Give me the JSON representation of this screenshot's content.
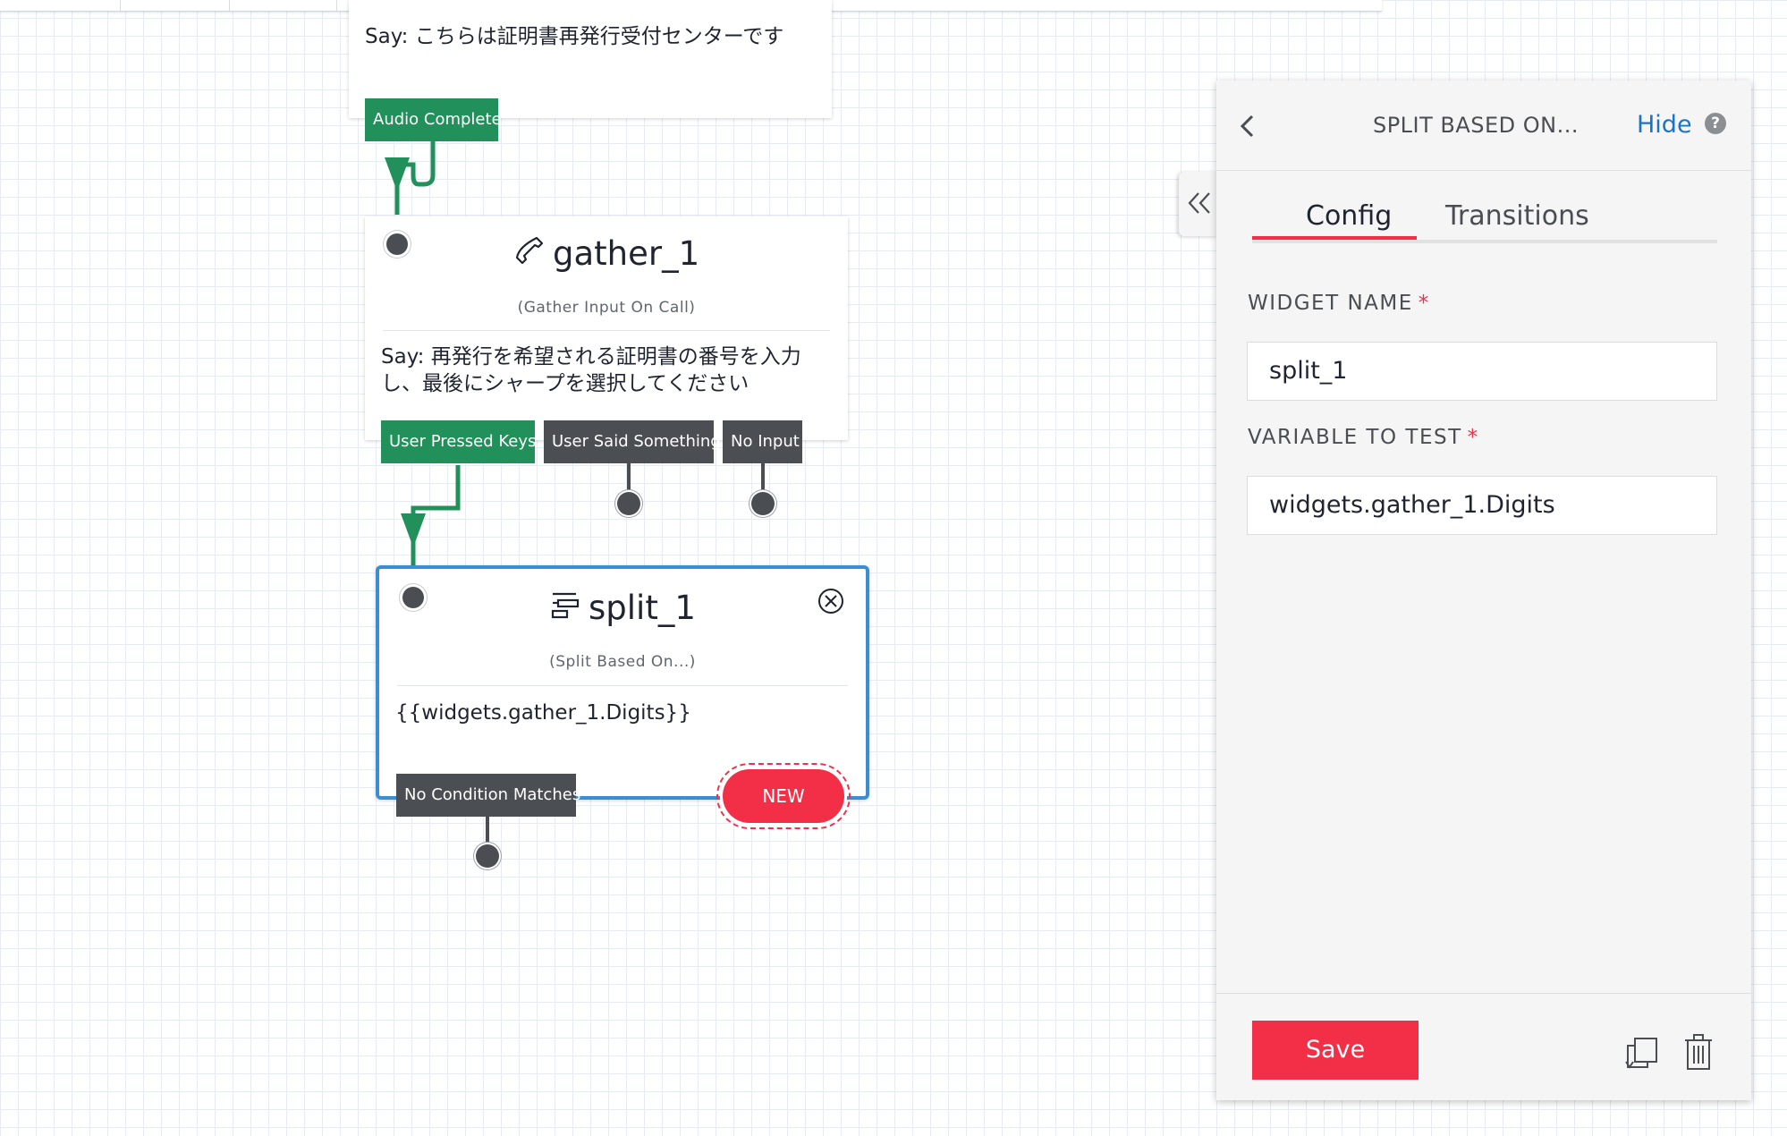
{
  "toolbar": {},
  "widgets": {
    "say_top": {
      "text": "Say: こちらは証明書再発行受付センターです"
    },
    "gather": {
      "title": "gather_1",
      "subtitle": "(Gather Input On Call)",
      "text": "Say: 再発行を希望される証明書の番号を入力し、最後にシャープを選択してください",
      "icon": "phone-icon"
    },
    "split": {
      "title": "split_1",
      "subtitle": "(Split Based On...)",
      "text": "{{widgets.gather_1.Digits}}",
      "icon": "split-icon",
      "new_label": "NEW"
    }
  },
  "transitions": {
    "audio_complete": "Audio Complete",
    "user_pressed_keys": "User Pressed Keys",
    "user_said_something": "User Said Something",
    "no_input": "No Input",
    "no_condition_matches": "No Condition Matches"
  },
  "panel": {
    "title": "SPLIT BASED ON...",
    "hide_label": "Hide",
    "help_glyph": "?",
    "tabs": [
      {
        "label": "Config",
        "active": true
      },
      {
        "label": "Transitions",
        "active": false
      }
    ],
    "fields": [
      {
        "label": "WIDGET NAME",
        "required_mark": "*",
        "value": "split_1"
      },
      {
        "label": "VARIABLE TO TEST",
        "required_mark": "*",
        "value": "widgets.gather_1.Digits"
      }
    ],
    "save_label": "Save"
  },
  "colors": {
    "accent_red": "#f22f46",
    "connector_green": "#22905a",
    "selection_blue": "#3b8ed0",
    "link_blue": "#1a74c7"
  }
}
